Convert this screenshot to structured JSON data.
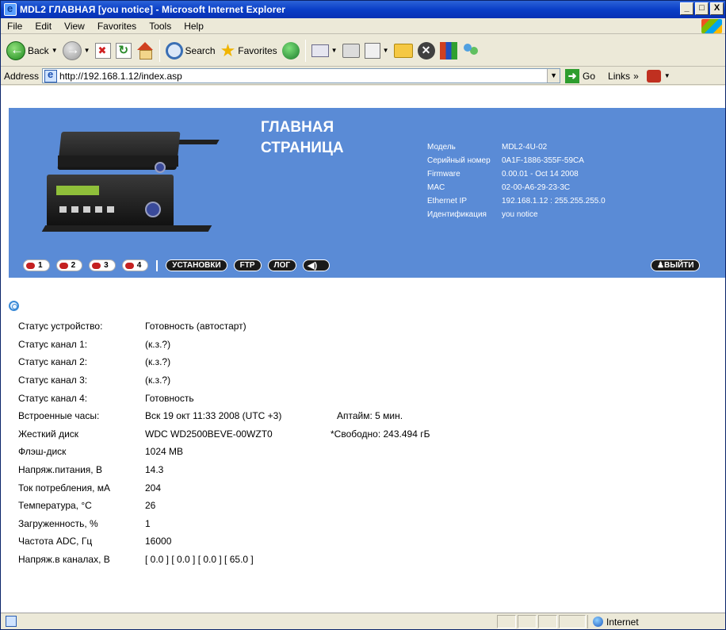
{
  "window": {
    "title": "MDL2 ГЛАВНАЯ [you notice] - Microsoft Internet Explorer",
    "controls": [
      "_",
      "□",
      "X"
    ]
  },
  "menu": [
    "File",
    "Edit",
    "View",
    "Favorites",
    "Tools",
    "Help"
  ],
  "toolbar": {
    "back": "Back",
    "search": "Search",
    "favorites": "Favorites"
  },
  "address": {
    "label": "Address",
    "url": "http://192.168.1.12/index.asp",
    "go": "Go",
    "links": "Links",
    "chevron": "»"
  },
  "banner": {
    "title_line1": "ГЛАВНАЯ",
    "title_line2": "СТРАНИЦА",
    "info": [
      {
        "k": "Модель",
        "v": "MDL2-4U-02"
      },
      {
        "k": "Серийный номер",
        "v": "0A1F-1886-355F-59CA"
      },
      {
        "k": "Firmware",
        "v": "0.00.01 - Oct 14 2008"
      },
      {
        "k": "MAC",
        "v": "02-00-A6-29-23-3C"
      },
      {
        "k": "Ethernet IP",
        "v": "192.168.1.12 : 255.255.255.0"
      },
      {
        "k": "Идентификация",
        "v": "you notice"
      }
    ]
  },
  "nav": {
    "channels": [
      "1",
      "2",
      "3",
      "4"
    ],
    "settings": "УСТАНОВКИ",
    "ftp": "FTP",
    "log": "ЛОГ",
    "sound": "◀)",
    "exit": "ВЫЙТИ"
  },
  "status": [
    {
      "label": "Статус устройство:",
      "value": "Готовность (автостарт)"
    },
    {
      "label": "Статус канал 1:",
      "value": "(к.з.?)"
    },
    {
      "label": "Статус канал 2:",
      "value": "(к.з.?)"
    },
    {
      "label": "Статус канал 3:",
      "value": "(к.з.?)"
    },
    {
      "label": "Статус канал 4:",
      "value": "Готовность"
    },
    {
      "label": "Встроенные часы:",
      "value": "Вск 19 окт 11:33 2008  (UTC +3)",
      "extra": "Аптайм: 5 мин."
    },
    {
      "label": "Жесткий диск",
      "value": "WDC WD2500BEVE-00WZT0",
      "extra": "*Свободно: 243.494 гБ"
    },
    {
      "label": "Флэш-диск",
      "value": "1024 MB"
    },
    {
      "label": "Напряж.питания, В",
      "value": "14.3"
    },
    {
      "label": "Ток потребления, мА",
      "value": "204"
    },
    {
      "label": "Температура, °С",
      "value": "26"
    },
    {
      "label": "Загруженность, %",
      "value": "1"
    },
    {
      "label": "Частота ADC, Гц",
      "value": "16000"
    },
    {
      "label": "Напряж.в каналах, В",
      "value": "[ 0.0 ]  [ 0.0 ]  [ 0.0 ]  [ 65.0 ]"
    }
  ],
  "statusbar": {
    "zone": "Internet"
  }
}
